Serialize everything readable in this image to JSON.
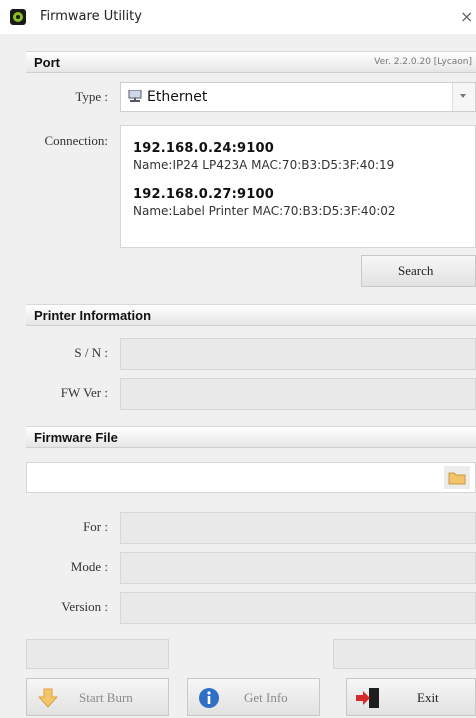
{
  "window": {
    "title": "Firmware Utility",
    "close_glyph": "×"
  },
  "port": {
    "header": "Port",
    "version": "Ver. 2.2.0.20 [Lycaon]",
    "type_label": "Type :",
    "type_value": "Ethernet",
    "connection_label": "Connection:",
    "connections": [
      {
        "address": "192.168.0.24:9100",
        "detail": "Name:IP24 LP423A MAC:70:B3:D5:3F:40:19"
      },
      {
        "address": "192.168.0.27:9100",
        "detail": "Name:Label Printer MAC:70:B3:D5:3F:40:02"
      }
    ],
    "search_label": "Search"
  },
  "printer_info": {
    "header": "Printer Information",
    "sn_label": "S / N :",
    "sn_value": "",
    "fw_label": "FW Ver :",
    "fw_value": ""
  },
  "firmware_file": {
    "header": "Firmware File",
    "path_value": "",
    "for_label": "For :",
    "for_value": "",
    "mode_label": "Mode :",
    "mode_value": "",
    "version_label": "Version :",
    "version_value": ""
  },
  "actions": {
    "start_burn": "Start Burn",
    "get_info": "Get Info",
    "exit": "Exit"
  },
  "icons": {
    "app": "app-logo-icon",
    "network": "network-icon",
    "folder": "folder-icon",
    "start_burn": "download-arrow-icon",
    "get_info": "info-icon",
    "exit": "exit-door-icon"
  },
  "colors": {
    "accent_green": "#8dbf1f",
    "info_blue": "#2f6fc6",
    "exit_red": "#d62b2b"
  }
}
